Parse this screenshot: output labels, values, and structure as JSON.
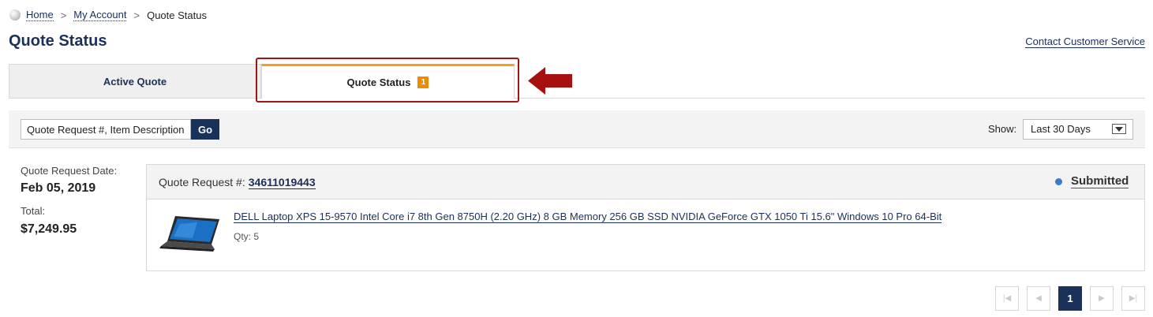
{
  "breadcrumb": {
    "home": "Home",
    "separator": ">",
    "my_account": "My Account",
    "current": "Quote Status"
  },
  "page": {
    "title": "Quote Status",
    "contact_link": "Contact Customer Service"
  },
  "tabs": {
    "active_quote": "Active Quote",
    "quote_status": "Quote Status",
    "quote_status_badge": "1"
  },
  "search": {
    "value": "Quote Request #, Item Description",
    "go_label": "Go",
    "show_label": "Show:",
    "show_value": "Last 30 Days"
  },
  "quote": {
    "date_label": "Quote Request Date:",
    "date": "Feb 05, 2019",
    "total_label": "Total:",
    "total": "$7,249.95",
    "number_label": "Quote Request #:",
    "number": "34611019443",
    "status": "Submitted",
    "item": {
      "description": "DELL Laptop XPS 15-9570 Intel Core i7 8th Gen 8750H (2.20 GHz) 8 GB Memory 256 GB SSD NVIDIA GeForce GTX 1050 Ti 15.6\" Windows 10 Pro 64-Bit",
      "qty": "Qty: 5"
    }
  },
  "pagination": {
    "first_icon": "first-page-icon",
    "prev_icon": "previous-page-icon",
    "current_page": "1",
    "next_icon": "next-page-icon",
    "last_icon": "last-page-icon"
  },
  "colors": {
    "brand_navy": "#1a3159",
    "tab_accent": "#f0a020",
    "badge": "#f08a00",
    "highlight_red": "#a01515",
    "status_dot": "#3b7cc9"
  }
}
